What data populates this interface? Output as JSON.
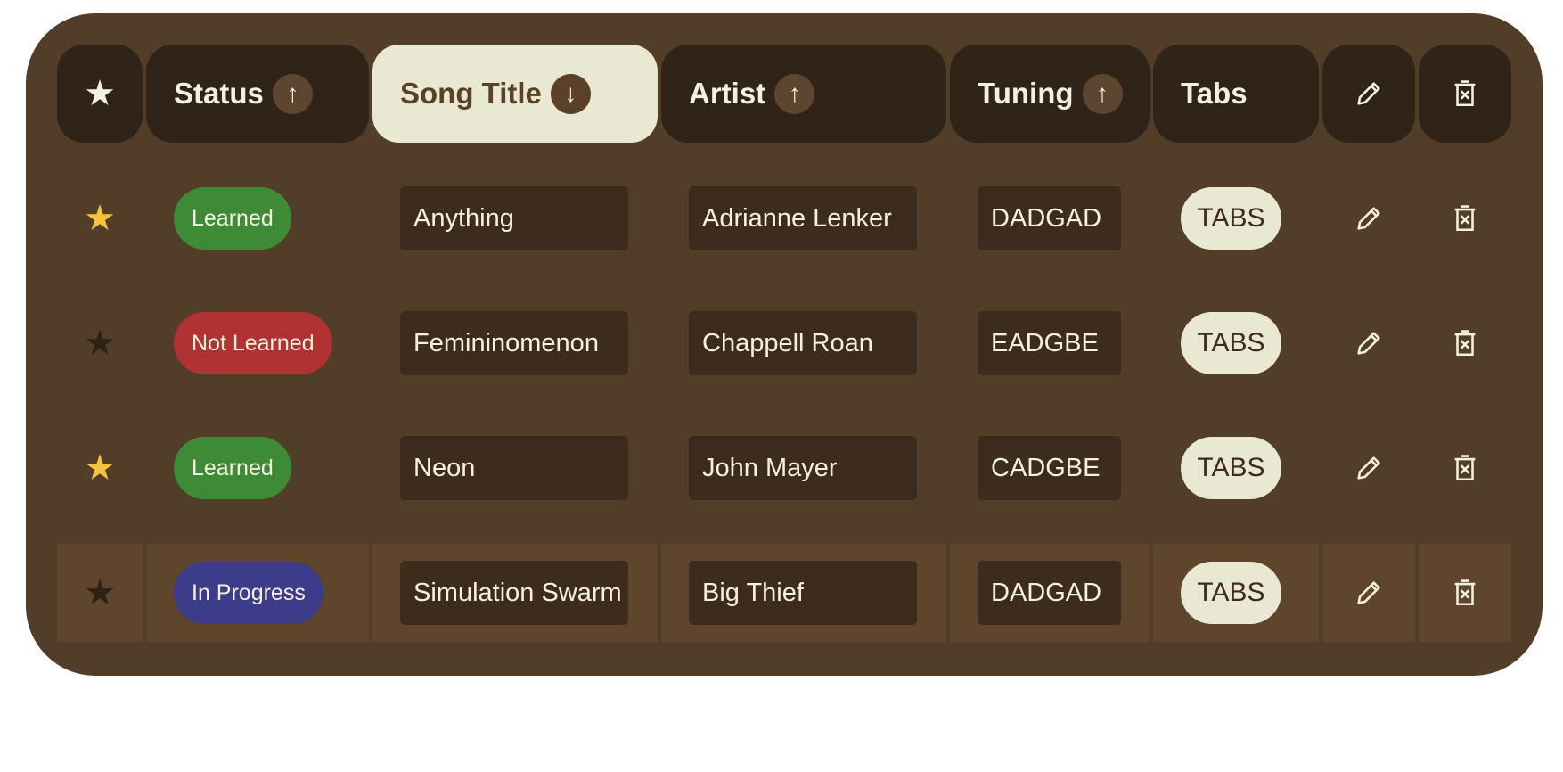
{
  "header": {
    "star_glyph": "★",
    "columns": [
      {
        "key": "status",
        "label": "Status",
        "sort": "↑"
      },
      {
        "key": "title",
        "label": "Song Title",
        "sort": "↓",
        "active": true
      },
      {
        "key": "artist",
        "label": "Artist",
        "sort": "↑"
      },
      {
        "key": "tuning",
        "label": "Tuning",
        "sort": "↑"
      },
      {
        "key": "tabs",
        "label": "Tabs"
      }
    ],
    "edit_icon": "pencil-icon",
    "delete_icon": "trash-x-icon"
  },
  "rows": [
    {
      "starred": true,
      "status": "Learned",
      "status_color": "#3d8b37",
      "title": "Anything",
      "artist": "Adrianne Lenker",
      "tuning": "DADGAD",
      "tabs": "TABS"
    },
    {
      "starred": false,
      "status": "Not Learned",
      "status_color": "#b03232",
      "title": "Femininomenon",
      "artist": "Chappell Roan",
      "tuning": "EADGBE",
      "tabs": "TABS"
    },
    {
      "starred": true,
      "status": "Learned",
      "status_color": "#3d8b37",
      "title": "Neon",
      "artist": "John Mayer",
      "tuning": "CADGBE",
      "tabs": "TABS"
    },
    {
      "starred": false,
      "status": "In Progress",
      "status_color": "#3d3c8a",
      "title": "Simulation Swarm",
      "artist": "Big Thief",
      "tuning": "DADGAD",
      "tabs": "TABS"
    }
  ],
  "colors": {
    "panel": "#523d28",
    "header_cell": "#302317",
    "active_header": "#e9e8d2",
    "star_on": "#f5c33b",
    "highlight_row": "#5e452c"
  }
}
